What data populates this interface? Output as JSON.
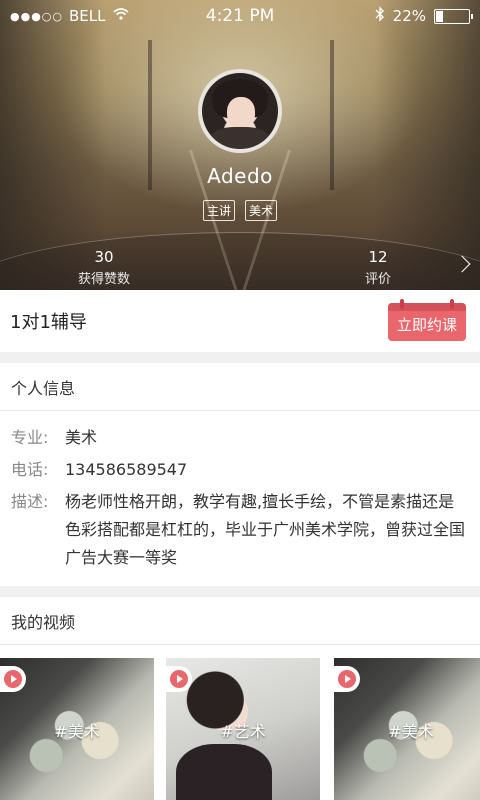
{
  "status_bar": {
    "signal_dots": "●●●○○",
    "carrier": "BELL",
    "time": "4:21 PM",
    "battery": "22%",
    "battery_level": 0.22
  },
  "profile": {
    "name": "Adedo",
    "tags": [
      "主讲",
      "美术"
    ],
    "stats": {
      "likes_value": "30",
      "likes_label": "获得赞数",
      "rating_value": "12",
      "rating_label": "评价"
    }
  },
  "tutoring": {
    "title": "1对1辅导",
    "book_button": "立即约课"
  },
  "personal_info": {
    "header": "个人信息",
    "major_label": "专业:",
    "major_value": "美术",
    "phone_label": "电话:",
    "phone_value": "134586589547",
    "desc_label": "描述:",
    "desc_value": "杨老师性格开朗，教学有趣,擅长手绘，不管是素描还是色彩搭配都是杠杠的，毕业于广州美术学院，曾获过全国广告大赛一等奖"
  },
  "videos": {
    "header": "我的视频",
    "items": [
      {
        "label": "#美术"
      },
      {
        "label": "#艺术"
      },
      {
        "label": "#美术"
      }
    ]
  },
  "colors": {
    "accent": "#e8666c"
  }
}
